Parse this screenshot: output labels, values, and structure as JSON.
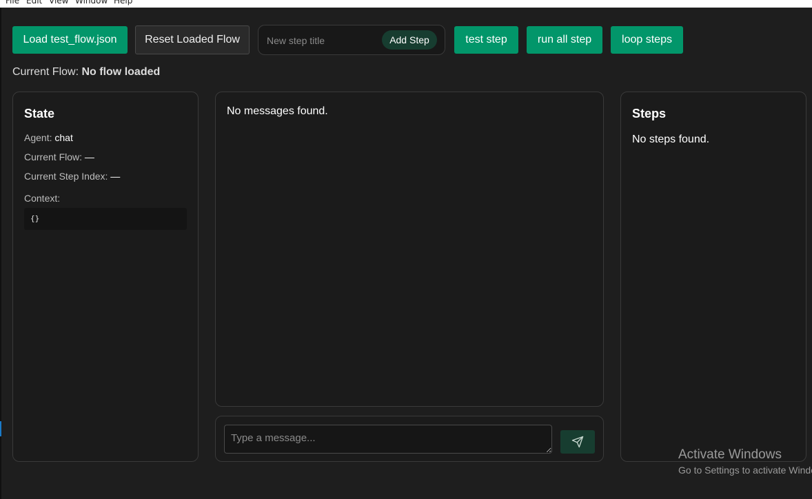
{
  "menubar": {
    "items": [
      "File",
      "Edit",
      "View",
      "Window",
      "Help"
    ]
  },
  "toolbar": {
    "load_label": "Load test_flow.json",
    "reset_label": "Reset Loaded Flow",
    "step_title_placeholder": "New step title",
    "add_step_label": "Add Step",
    "test_step_label": "test step",
    "run_all_label": "run all step",
    "loop_steps_label": "loop steps"
  },
  "current_flow": {
    "label": "Current Flow:",
    "value": "No flow loaded"
  },
  "state_panel": {
    "title": "State",
    "agent_label": "Agent:",
    "agent_value": "chat",
    "flow_label": "Current Flow:",
    "flow_value": "—",
    "step_index_label": "Current Step Index:",
    "step_index_value": "—",
    "context_label": "Context:",
    "context_value": "{}"
  },
  "messages_panel": {
    "empty_text": "No messages found."
  },
  "chat": {
    "placeholder": "Type a message...",
    "send_icon": "send-icon"
  },
  "steps_panel": {
    "title": "Steps",
    "empty_text": "No steps found."
  },
  "watermark": {
    "line1": "Activate Windows",
    "line2": "Go to Settings to activate Windows."
  },
  "colors": {
    "accent_green": "#02966a",
    "dark_green": "#173d30",
    "background": "#1e1e1e",
    "panel": "#1b1b1b"
  }
}
